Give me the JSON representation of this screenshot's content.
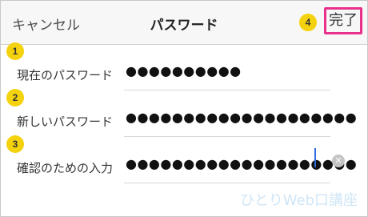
{
  "navbar": {
    "cancel_label": "キャンセル",
    "title": "パスワード",
    "done_label": "完了"
  },
  "fields": [
    {
      "label": "現在のパスワード",
      "value": "●●●●●●●●●●"
    },
    {
      "label": "新しいパスワード",
      "value": "●●●●●●●●●●●●●●●●●●●●"
    },
    {
      "label": "確認のための入力",
      "value": "●●●●●●●●●●●●●●●●●●●●"
    }
  ],
  "annotations": {
    "badge1": "1",
    "badge2": "2",
    "badge3": "3",
    "badge4": "4"
  },
  "clear_glyph": "✕",
  "watermark": "ひとりWeb口講座",
  "colors": {
    "highlight_border": "#e8318a",
    "badge": "#f4d20e",
    "caret": "#2f6ce0"
  }
}
